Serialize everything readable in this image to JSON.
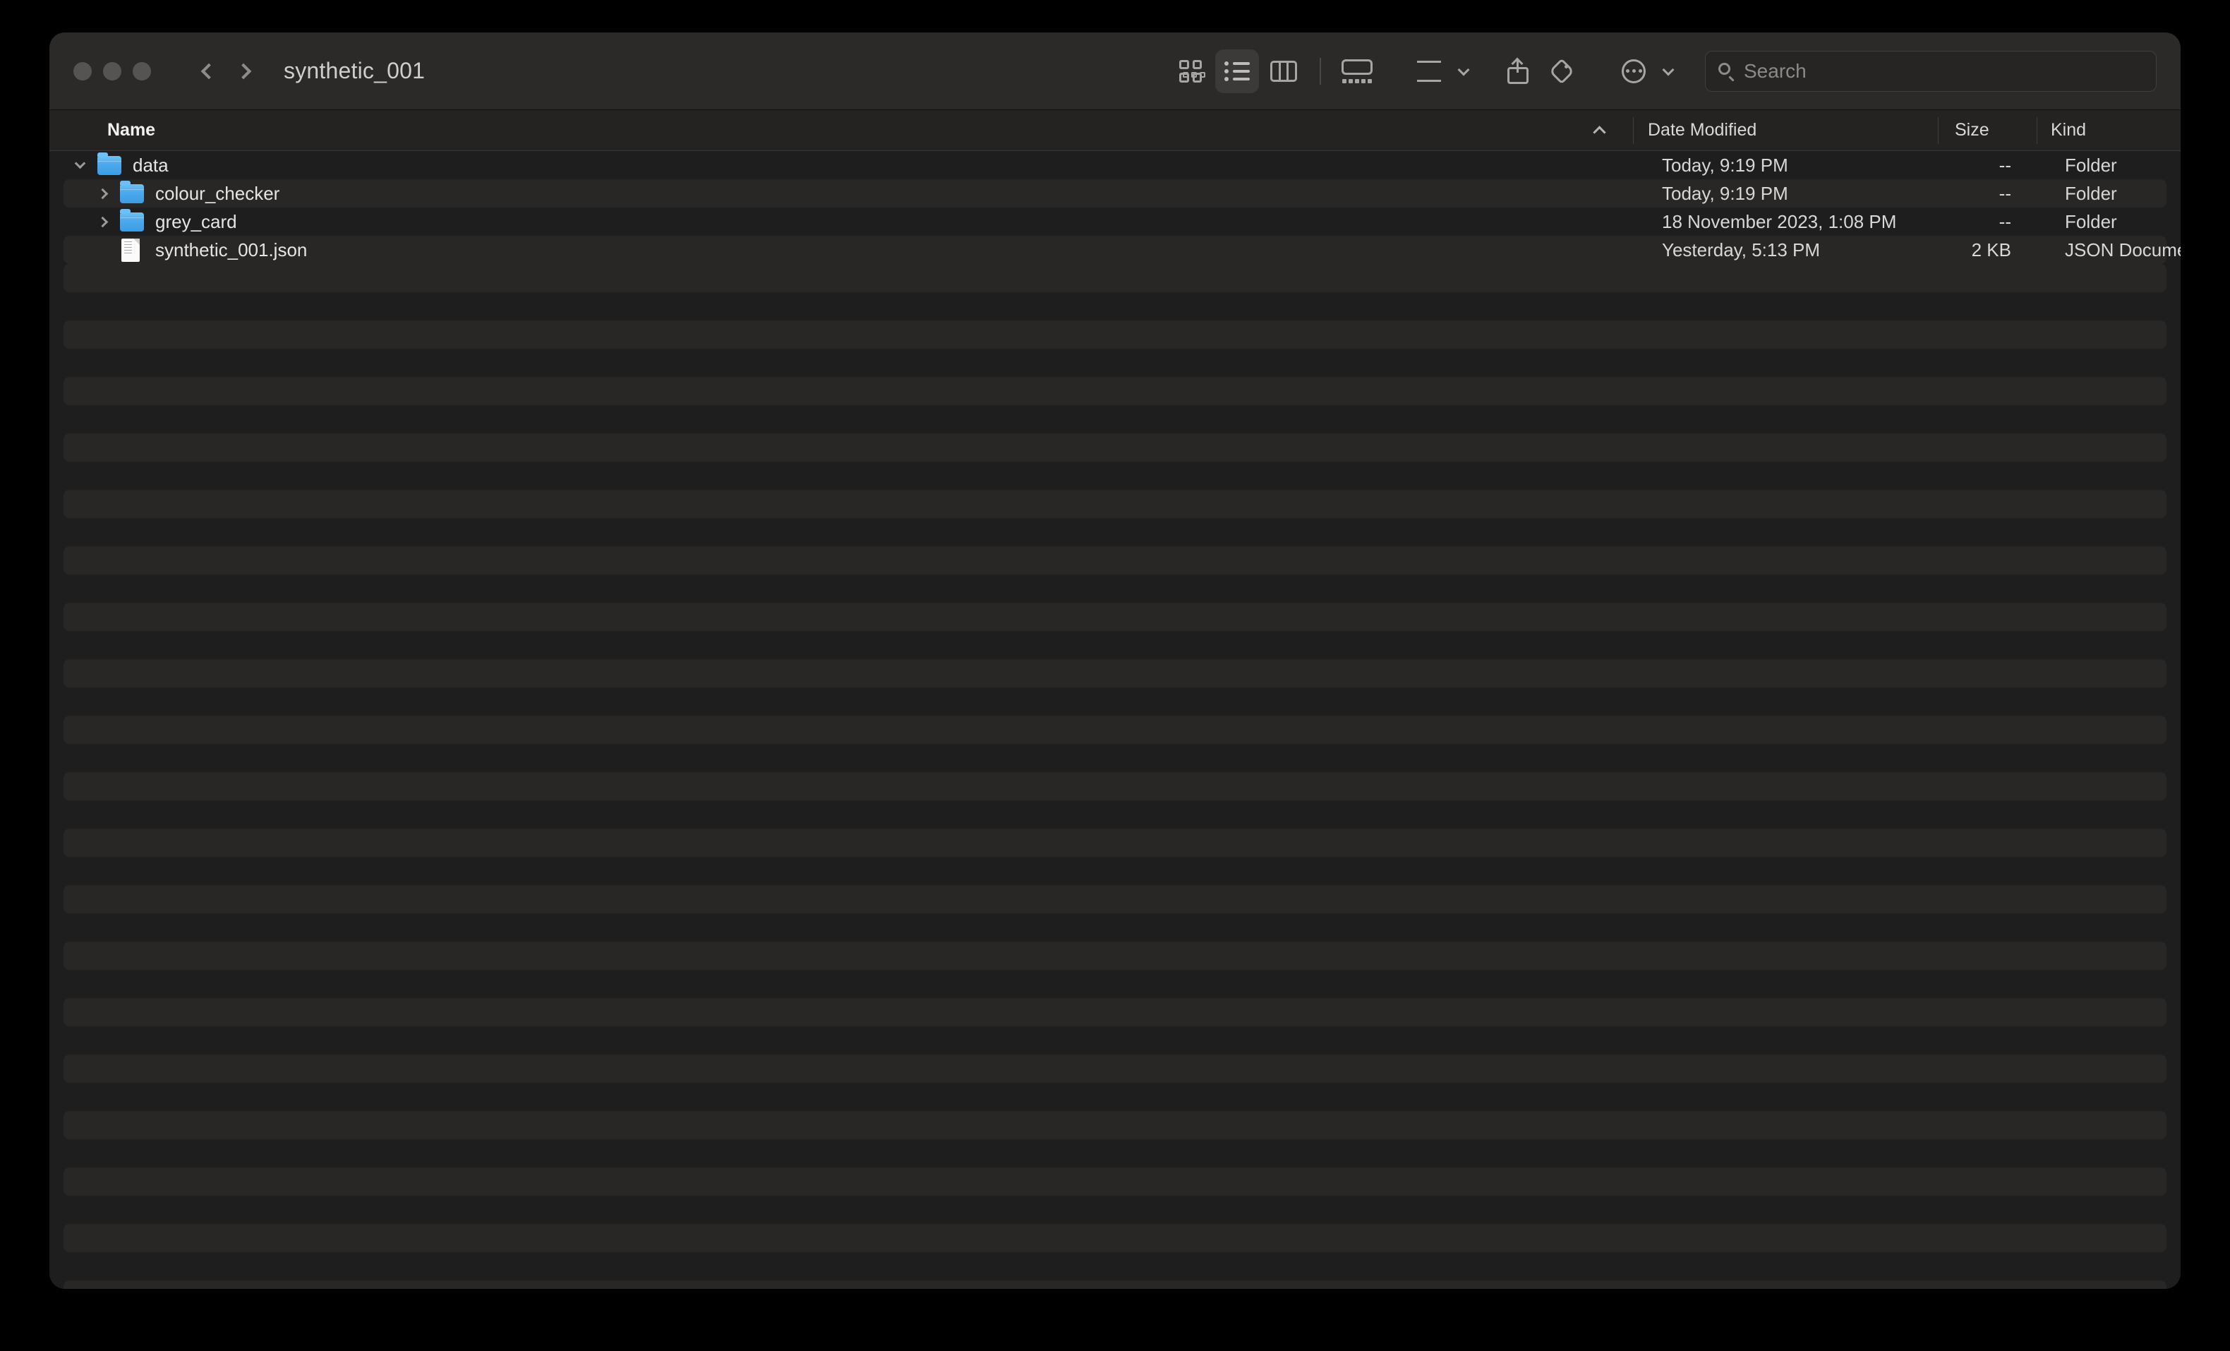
{
  "window": {
    "title": "synthetic_001",
    "traffic_lights": [
      "close-button",
      "minimize-button",
      "zoom-button"
    ]
  },
  "toolbar": {
    "back_icon": "chevron-left-icon",
    "forward_icon": "chevron-right-icon",
    "view_buttons": [
      {
        "name": "icon-view",
        "icon": "grid-icon",
        "selected": false
      },
      {
        "name": "list-view",
        "icon": "list-icon",
        "selected": true
      },
      {
        "name": "column-view",
        "icon": "columns-icon",
        "selected": false
      },
      {
        "name": "gallery-view",
        "icon": "gallery-icon",
        "selected": false
      }
    ],
    "group_icon": "group-by-icon",
    "share_icon": "share-icon",
    "tag_icon": "tag-icon",
    "more_icon": "ellipsis-circle-icon",
    "chevron_icon": "chevron-down-icon"
  },
  "search": {
    "placeholder": "Search",
    "value": "",
    "icon": "search-icon"
  },
  "columns": {
    "name": "Name",
    "date_modified": "Date Modified",
    "size": "Size",
    "kind": "Kind",
    "sort_indicator": "ascending"
  },
  "files": [
    {
      "name": "data",
      "icon": "folder-icon",
      "depth": 0,
      "disclosure": "expanded",
      "date_modified": "Today, 9:19 PM",
      "size": "--",
      "kind": "Folder"
    },
    {
      "name": "colour_checker",
      "icon": "folder-icon",
      "depth": 1,
      "disclosure": "collapsed",
      "date_modified": "Today, 9:19 PM",
      "size": "--",
      "kind": "Folder"
    },
    {
      "name": "grey_card",
      "icon": "folder-icon",
      "depth": 1,
      "disclosure": "collapsed",
      "date_modified": "18 November 2023, 1:08 PM",
      "size": "--",
      "kind": "Folder"
    },
    {
      "name": "synthetic_001.json",
      "icon": "json-document-icon",
      "depth": 1,
      "disclosure": "none",
      "date_modified": "Yesterday, 5:13 PM",
      "size": "2 KB",
      "kind": "JSON Document"
    }
  ],
  "colors": {
    "window_background": "#1e1e1e",
    "toolbar_background": "#2b2a29",
    "stripe": "#282726",
    "folder_blue": "#4aa8ec",
    "text": "#e6e5e4"
  }
}
